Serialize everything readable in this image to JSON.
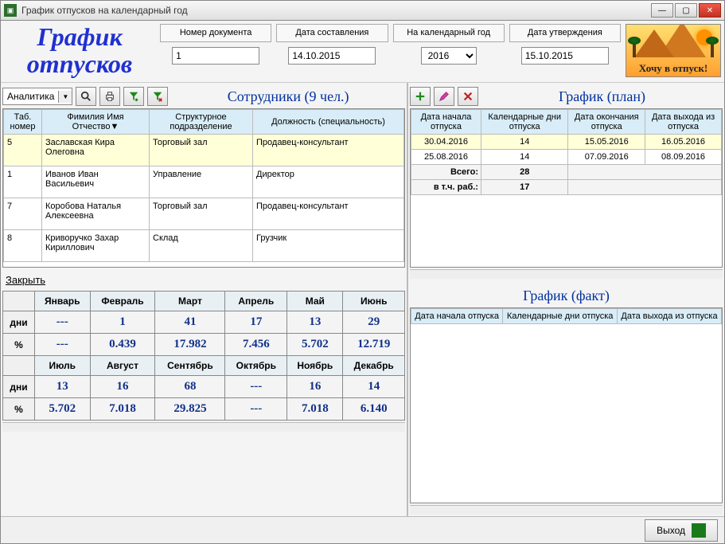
{
  "window_title": "График отпусков на календарный год",
  "header": {
    "logo_text": "График отпусков",
    "doc_number": {
      "label": "Номер документа",
      "value": "1"
    },
    "date_created": {
      "label": "Дата составления",
      "value": "14.10.2015"
    },
    "calendar_year": {
      "label": "На календарный год",
      "value": "2016"
    },
    "date_approved": {
      "label": "Дата утверждения",
      "value": "15.10.2015"
    },
    "promo_text": "Хочу в отпуск!"
  },
  "employees": {
    "analytics_label": "Аналитика",
    "title": "Сотрудники (9 чел.)",
    "columns": {
      "tab_no": "Таб. номер",
      "fio": "Фимилия Имя Отчество",
      "dept": "Структурное подразделение",
      "position": "Должность (специальность)"
    },
    "rows": [
      {
        "tab": 5,
        "fio": "Заславская Кира Олеговна",
        "dept": "Торговый зал",
        "pos": "Продавец-консультант",
        "selected": true
      },
      {
        "tab": 1,
        "fio": "Иванов Иван Васильевич",
        "dept": "Управление",
        "pos": "Директор"
      },
      {
        "tab": 7,
        "fio": "Коробова Наталья Алексеевна",
        "dept": "Торговый зал",
        "pos": "Продавец-консультант"
      },
      {
        "tab": 8,
        "fio": "Криворучко Захар Кириллович",
        "dept": "Склад",
        "pos": "Грузчик"
      }
    ]
  },
  "close_label": "Закрыть",
  "month_stats": {
    "months1": [
      "Январь",
      "Февраль",
      "Март",
      "Апрель",
      "Май",
      "Июнь"
    ],
    "days1": [
      "---",
      "1",
      "41",
      "17",
      "13",
      "29"
    ],
    "pct1": [
      "---",
      "0.439",
      "17.982",
      "7.456",
      "5.702",
      "12.719"
    ],
    "months2": [
      "Июль",
      "Август",
      "Сентябрь",
      "Октябрь",
      "Ноябрь",
      "Декабрь"
    ],
    "days2": [
      "13",
      "16",
      "68",
      "---",
      "16",
      "14"
    ],
    "pct2": [
      "5.702",
      "7.018",
      "29.825",
      "---",
      "7.018",
      "6.140"
    ],
    "row_days_label": "дни",
    "row_pct_label": "%"
  },
  "plan": {
    "title": "График (план)",
    "columns": {
      "start": "Дата начала отпуска",
      "days": "Календарные дни отпуска",
      "end": "Дата окончания отпуска",
      "exit": "Дата выхода из отпуска"
    },
    "rows": [
      {
        "start": "30.04.2016",
        "days": 14,
        "end": "15.05.2016",
        "exit": "16.05.2016",
        "selected": true
      },
      {
        "start": "25.08.2016",
        "days": 14,
        "end": "07.09.2016",
        "exit": "08.09.2016"
      }
    ],
    "total_label": "Всего:",
    "total_value": 28,
    "work_label": "в т.ч. раб.:",
    "work_value": 17
  },
  "fact": {
    "title": "График (факт)",
    "columns": {
      "start": "Дата начала отпуска",
      "days": "Календарные дни отпуска",
      "exit": "Дата выхода из отпуска"
    }
  },
  "exit_label": "Выход",
  "icons": {
    "search": "search",
    "print": "print",
    "filter_add": "filter-add",
    "filter_clear": "filter-clear",
    "add": "add",
    "edit": "edit",
    "delete": "delete"
  }
}
